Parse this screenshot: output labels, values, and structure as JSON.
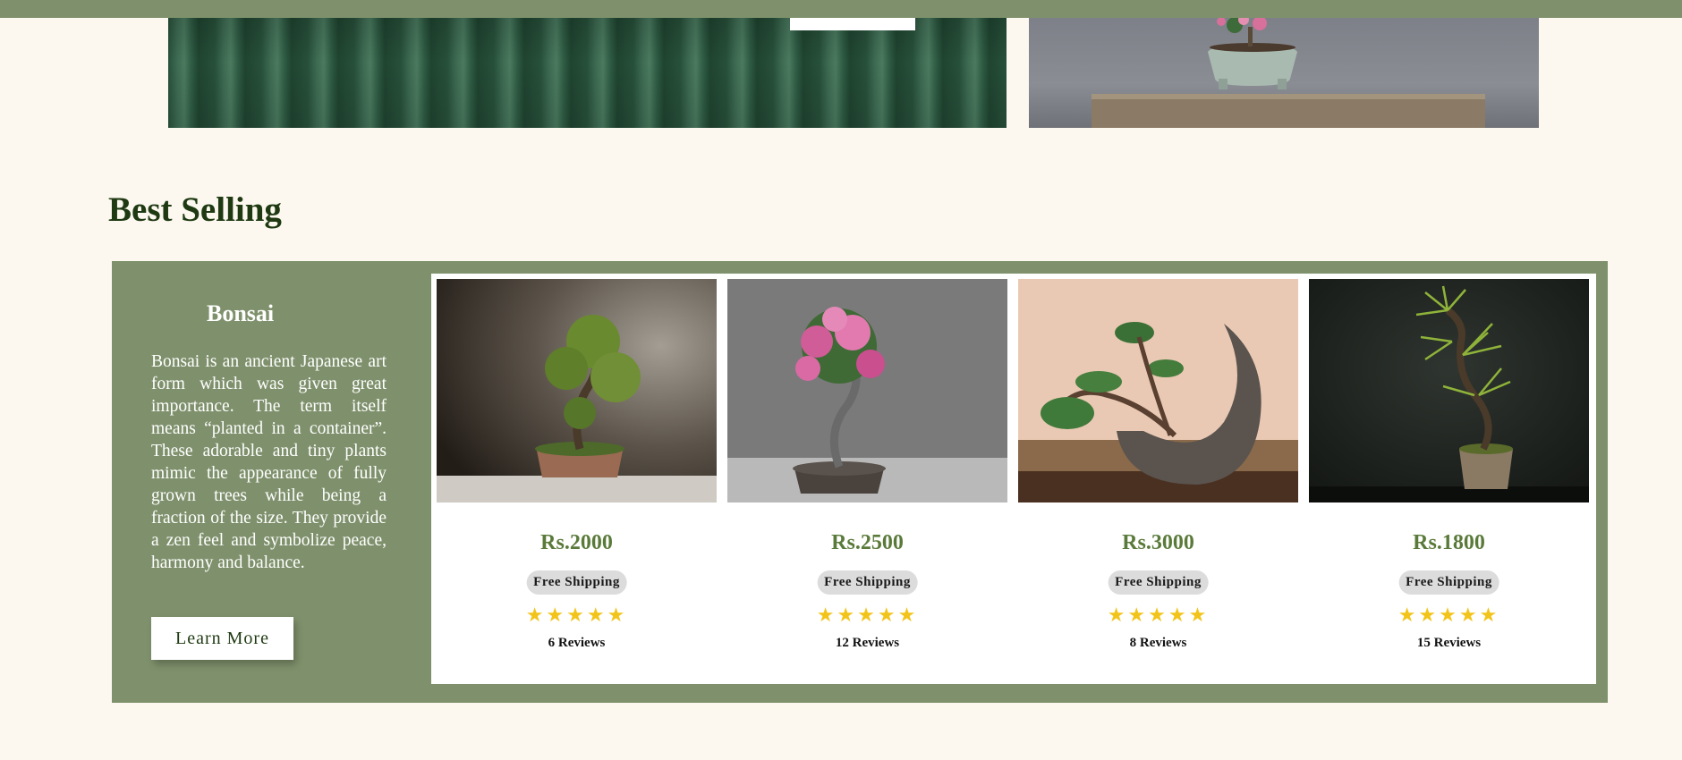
{
  "section": {
    "title": "Best Selling"
  },
  "intro": {
    "title": "Bonsai",
    "text": "Bonsai is an ancient Japanese art form which was given great importance. The term itself means “planted in a container”. These adorable and tiny plants mimic the appearance of fully grown trees while being a fraction of the size. They provide a zen feel and symbolize peace, harmony and balance.",
    "button": "Learn More"
  },
  "products": [
    {
      "price": "Rs.2000",
      "shipping": "Free Shipping",
      "rating": 5,
      "stars": "★★★★★",
      "reviews": "6 Reviews"
    },
    {
      "price": "Rs.2500",
      "shipping": "Free Shipping",
      "rating": 5,
      "stars": "★★★★★",
      "reviews": "12 Reviews"
    },
    {
      "price": "Rs.3000",
      "shipping": "Free Shipping",
      "rating": 5,
      "stars": "★★★★★",
      "reviews": "8 Reviews"
    },
    {
      "price": "Rs.1800",
      "shipping": "Free Shipping",
      "rating": 5,
      "stars": "★★★★★",
      "reviews": "15 Reviews"
    }
  ],
  "colors": {
    "background": "#fcf8f0",
    "accent_green": "#7f916c",
    "title_green": "#1f3a12",
    "price_green": "#5a7a3a",
    "star_yellow": "#f2c41a"
  }
}
